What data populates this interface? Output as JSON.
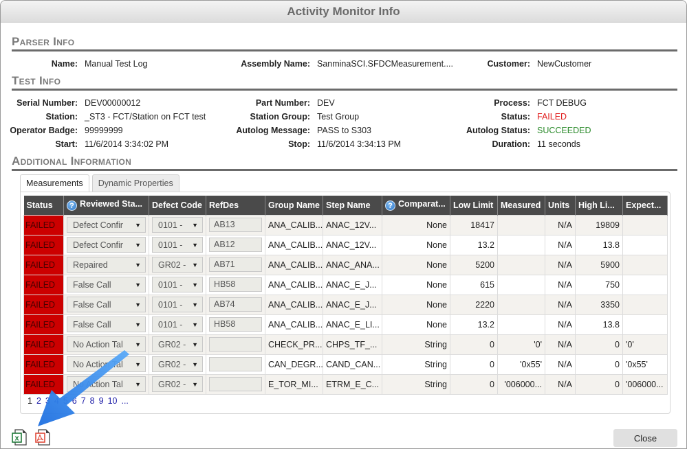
{
  "dialog": {
    "title": "Activity Monitor Info"
  },
  "parser_info": {
    "title": "Parser Info",
    "name": {
      "label": "Name:",
      "value": "Manual Test Log"
    },
    "assembly_name": {
      "label": "Assembly Name:",
      "value": "SanminaSCI.SFDCMeasurement...."
    },
    "customer": {
      "label": "Customer:",
      "value": "NewCustomer"
    }
  },
  "test_info": {
    "title": "Test Info",
    "serial_number": {
      "label": "Serial Number:",
      "value": "DEV00000012"
    },
    "station": {
      "label": "Station:",
      "value": "_ST3 - FCT/Station on FCT test"
    },
    "operator_badge": {
      "label": "Operator Badge:",
      "value": "99999999"
    },
    "start": {
      "label": "Start:",
      "value": "11/6/2014 3:34:02 PM"
    },
    "part_number": {
      "label": "Part Number:",
      "value": "DEV"
    },
    "station_group": {
      "label": "Station Group:",
      "value": "Test Group"
    },
    "autolog_message": {
      "label": "Autolog Message:",
      "value": "PASS to S303"
    },
    "stop": {
      "label": "Stop:",
      "value": "11/6/2014 3:34:13 PM"
    },
    "process": {
      "label": "Process:",
      "value": "FCT DEBUG"
    },
    "status": {
      "label": "Status:",
      "value": "FAILED",
      "color": "#e01b1b"
    },
    "autolog_status": {
      "label": "Autolog Status:",
      "value": "SUCCEEDED",
      "color": "#2a8a2a"
    },
    "duration": {
      "label": "Duration:",
      "value": "11 seconds"
    }
  },
  "additional_info": {
    "title": "Additional Information",
    "tabs": [
      {
        "label": "Measurements",
        "active": true
      },
      {
        "label": "Dynamic Properties",
        "active": false
      }
    ]
  },
  "measurements": {
    "columns": [
      "Status",
      "Reviewed Sta...",
      "Defect Code",
      "RefDes",
      "Group Name",
      "Step Name",
      "Comparat...",
      "Low Limit",
      "Measured",
      "Units",
      "High Li...",
      "Expect..."
    ],
    "rows": [
      {
        "status": "FAILED",
        "reviewed": "Defect Confir",
        "defect": "0101 -",
        "refdes": "AB13",
        "group": "ANA_CALIB...",
        "step": "ANAC_12V...",
        "comparator": "None",
        "low": "18417",
        "measured": "",
        "units": "N/A",
        "high": "19809",
        "expected": ""
      },
      {
        "status": "FAILED",
        "reviewed": "Defect Confir",
        "defect": "0101 -",
        "refdes": "AB12",
        "group": "ANA_CALIB...",
        "step": "ANAC_12V...",
        "comparator": "None",
        "low": "13.2",
        "measured": "",
        "units": "N/A",
        "high": "13.8",
        "expected": ""
      },
      {
        "status": "FAILED",
        "reviewed": "Repaired",
        "defect": "GR02 -",
        "refdes": "AB71",
        "group": "ANA_CALIB...",
        "step": "ANAC_ANA...",
        "comparator": "None",
        "low": "5200",
        "measured": "",
        "units": "N/A",
        "high": "5900",
        "expected": ""
      },
      {
        "status": "FAILED",
        "reviewed": "False Call",
        "defect": "0101 -",
        "refdes": "HB58",
        "group": "ANA_CALIB...",
        "step": "ANAC_E_J...",
        "comparator": "None",
        "low": "615",
        "measured": "",
        "units": "N/A",
        "high": "750",
        "expected": ""
      },
      {
        "status": "FAILED",
        "reviewed": "False Call",
        "defect": "0101 -",
        "refdes": "AB74",
        "group": "ANA_CALIB...",
        "step": "ANAC_E_J...",
        "comparator": "None",
        "low": "2220",
        "measured": "",
        "units": "N/A",
        "high": "3350",
        "expected": ""
      },
      {
        "status": "FAILED",
        "reviewed": "False Call",
        "defect": "0101 -",
        "refdes": "HB58",
        "group": "ANA_CALIB...",
        "step": "ANAC_E_LI...",
        "comparator": "None",
        "low": "13.2",
        "measured": "",
        "units": "N/A",
        "high": "13.8",
        "expected": ""
      },
      {
        "status": "FAILED",
        "reviewed": "No Action Tal",
        "defect": "GR02 -",
        "refdes": "",
        "group": "CHECK_PR...",
        "step": "CHPS_TF_...",
        "comparator": "String",
        "low": "0",
        "measured": "'0'",
        "units": "N/A",
        "high": "0",
        "expected": "'0'"
      },
      {
        "status": "FAILED",
        "reviewed": "No Action Tal",
        "defect": "GR02 -",
        "refdes": "",
        "group": "CAN_DEGR...",
        "step": "CAND_CAN...",
        "comparator": "String",
        "low": "0",
        "measured": "'0x55'",
        "units": "N/A",
        "high": "0",
        "expected": "'0x55'"
      },
      {
        "status": "FAILED",
        "reviewed": "No Action Tal",
        "defect": "GR02 -",
        "refdes": "",
        "group": "E_TOR_MI...",
        "step": "ETRM_E_C...",
        "comparator": "String",
        "low": "0",
        "measured": "'006000...",
        "units": "N/A",
        "high": "0",
        "expected": "'006000..."
      }
    ],
    "pager": [
      "1",
      "2",
      "3",
      "4",
      "5",
      "6",
      "7",
      "8",
      "9",
      "10",
      "..."
    ]
  },
  "footer": {
    "export_excel_icon": "excel-icon",
    "export_pdf_icon": "pdf-icon",
    "close_label": "Close"
  },
  "annotation": {
    "type": "arrow",
    "color": "#2f8ef0",
    "points_to": "export icons"
  }
}
